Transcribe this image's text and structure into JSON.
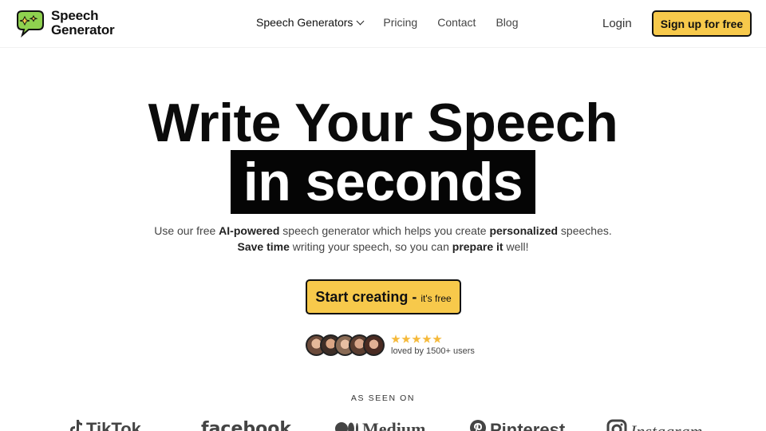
{
  "header": {
    "logo_line1": "Speech",
    "logo_line2": "Generator",
    "nav": {
      "speech_generators": "Speech Generators",
      "pricing": "Pricing",
      "contact": "Contact",
      "blog": "Blog"
    },
    "login": "Login",
    "signup": "Sign up for free"
  },
  "hero": {
    "title_line1": "Write Your Speech",
    "title_line2": "in seconds",
    "sub1_a": "Use our free ",
    "sub1_b": "AI-powered",
    "sub1_c": " speech generator which helps you create ",
    "sub1_d": "personalized",
    "sub1_e": " speeches.",
    "sub2_a": "Save time",
    "sub2_b": " writing your speech, so you can ",
    "sub2_c": "prepare it",
    "sub2_d": " well!",
    "cta_main": "Start creating -",
    "cta_small": "it's free"
  },
  "social_proof": {
    "stars": 5,
    "loved": "loved by 1500+ users"
  },
  "seen_on": {
    "label": "AS SEEN ON",
    "brands": [
      "TikTok",
      "facebook",
      "Medium",
      "Pinterest",
      "Instagram"
    ]
  },
  "colors": {
    "accent": "#f7c94b",
    "logo_green": "#8fd14f",
    "star": "#f5b93a"
  }
}
